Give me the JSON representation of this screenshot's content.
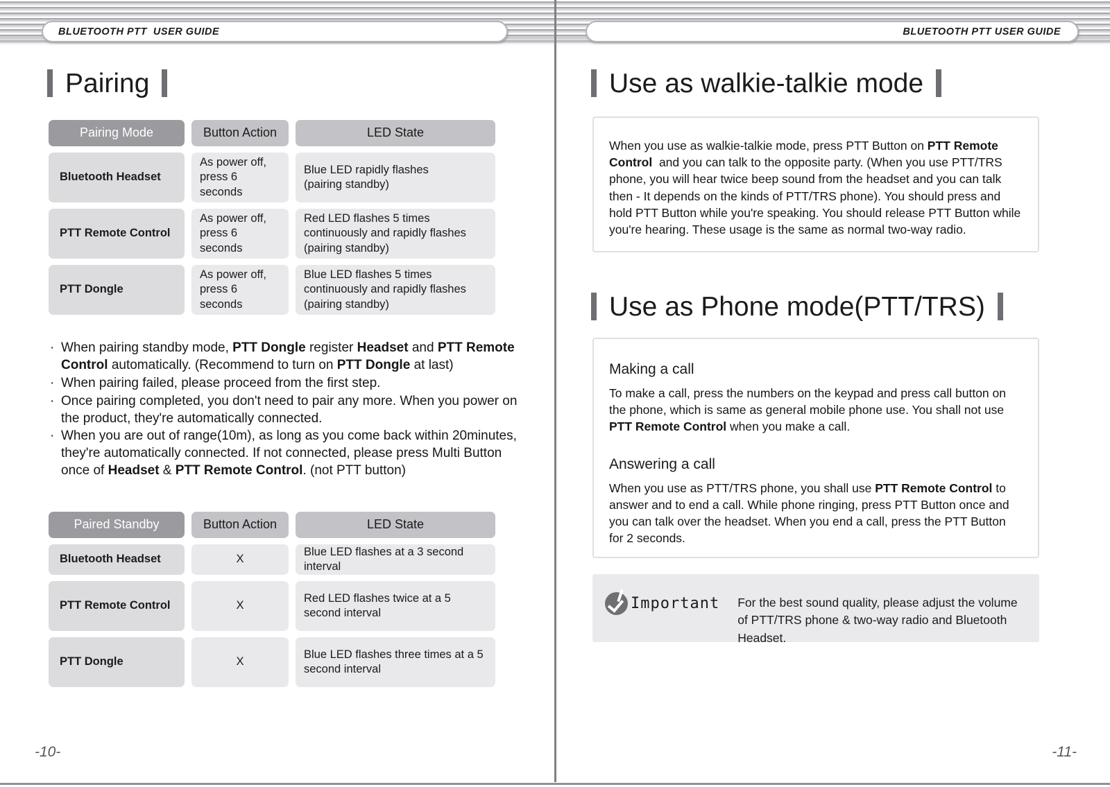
{
  "left_page": {
    "running_header": "BLUETOOTH PTT  USER GUIDE",
    "page_number": "-10-",
    "section_title": "Pairing",
    "pairing_table": {
      "headers": [
        "Pairing Mode",
        "Button Action",
        "LED State"
      ],
      "rows": [
        {
          "mode": "Bluetooth Headset",
          "action": "As power off,\npress 6 seconds",
          "led": "Blue LED rapidly flashes\n(pairing standby)"
        },
        {
          "mode": "PTT Remote Control",
          "action": "As power off,\npress 6 seconds",
          "led": "Red LED flashes 5 times continuously and rapidly flashes (pairing standby)"
        },
        {
          "mode": "PTT Dongle",
          "action": "As power off,\npress 6 seconds",
          "led": "Blue LED flashes 5 times continuously and rapidly flashes (pairing standby)"
        }
      ]
    },
    "notes": [
      "When pairing standby mode, PTT Dongle register Headset and PTT Remote Control automatically. (Recommend to turn on PTT Dongle at last)",
      "When pairing failed, please proceed from the first step.",
      "Once pairing completed, you don't need to pair any more. When you power on the product, they're automatically connected.",
      "When you are out of range(10m), as long as you come back within 20minutes, they're automatically connected. If not connected, please press Multi Button once of Headset & PTT Remote Control. (not PTT button)"
    ],
    "standby_table": {
      "headers": [
        "Paired Standby",
        "Button Action",
        "LED State"
      ],
      "rows": [
        {
          "mode": "Bluetooth Headset",
          "action": "X",
          "led": "Blue LED flashes at a 3 second interval"
        },
        {
          "mode": "PTT Remote Control",
          "action": "X",
          "led": "Red LED flashes twice at a 5 second interval"
        },
        {
          "mode": "PTT Dongle",
          "action": "X",
          "led": "Blue LED flashes three times at a 5 second interval"
        }
      ]
    }
  },
  "right_page": {
    "running_header": "BLUETOOTH PTT USER GUIDE",
    "page_number": "-11-",
    "walkie_section": {
      "title": "Use as walkie-talkie mode",
      "body": "When you use as walkie-talkie mode, press PTT Button on PTT Remote Control  and you can talk to the opposite party. (When you use PTT/TRS phone, you will hear twice beep sound from the headset and you can talk then - It depends on the kinds of PTT/TRS phone). You should press and hold PTT Button while you're speaking. You should release PTT Button while you're hearing. These usage is the same as normal two-way radio."
    },
    "phone_section": {
      "title": "Use as Phone mode(PTT/TRS)",
      "making_call_head": "Making a call",
      "making_call_body": "To make a call, press the numbers on the keypad and press call button on the phone, which is same as general mobile phone use. You shall not use PTT Remote Control when you make a call.",
      "answering_call_head": "Answering a call",
      "answering_call_body": "When you use as PTT/TRS phone, you shall use PTT Remote Control to answer and to end a call. While phone ringing, press PTT Button once and you can talk over the headset. When you end a call, press the PTT Button for 2 seconds."
    },
    "important_callout": {
      "label": "Important",
      "text": "For the best sound quality, please adjust the volume of PTT/TRS phone & two-way radio and Bluetooth Headset."
    }
  },
  "colors": {
    "header_primary": "#9a9a9f",
    "header_secondary": "#c3c3c7",
    "cell_first": "#dcdcdf",
    "cell_body": "#e9e9eb",
    "bar": "#6e6e73",
    "callout_bg": "#eaeaec"
  }
}
